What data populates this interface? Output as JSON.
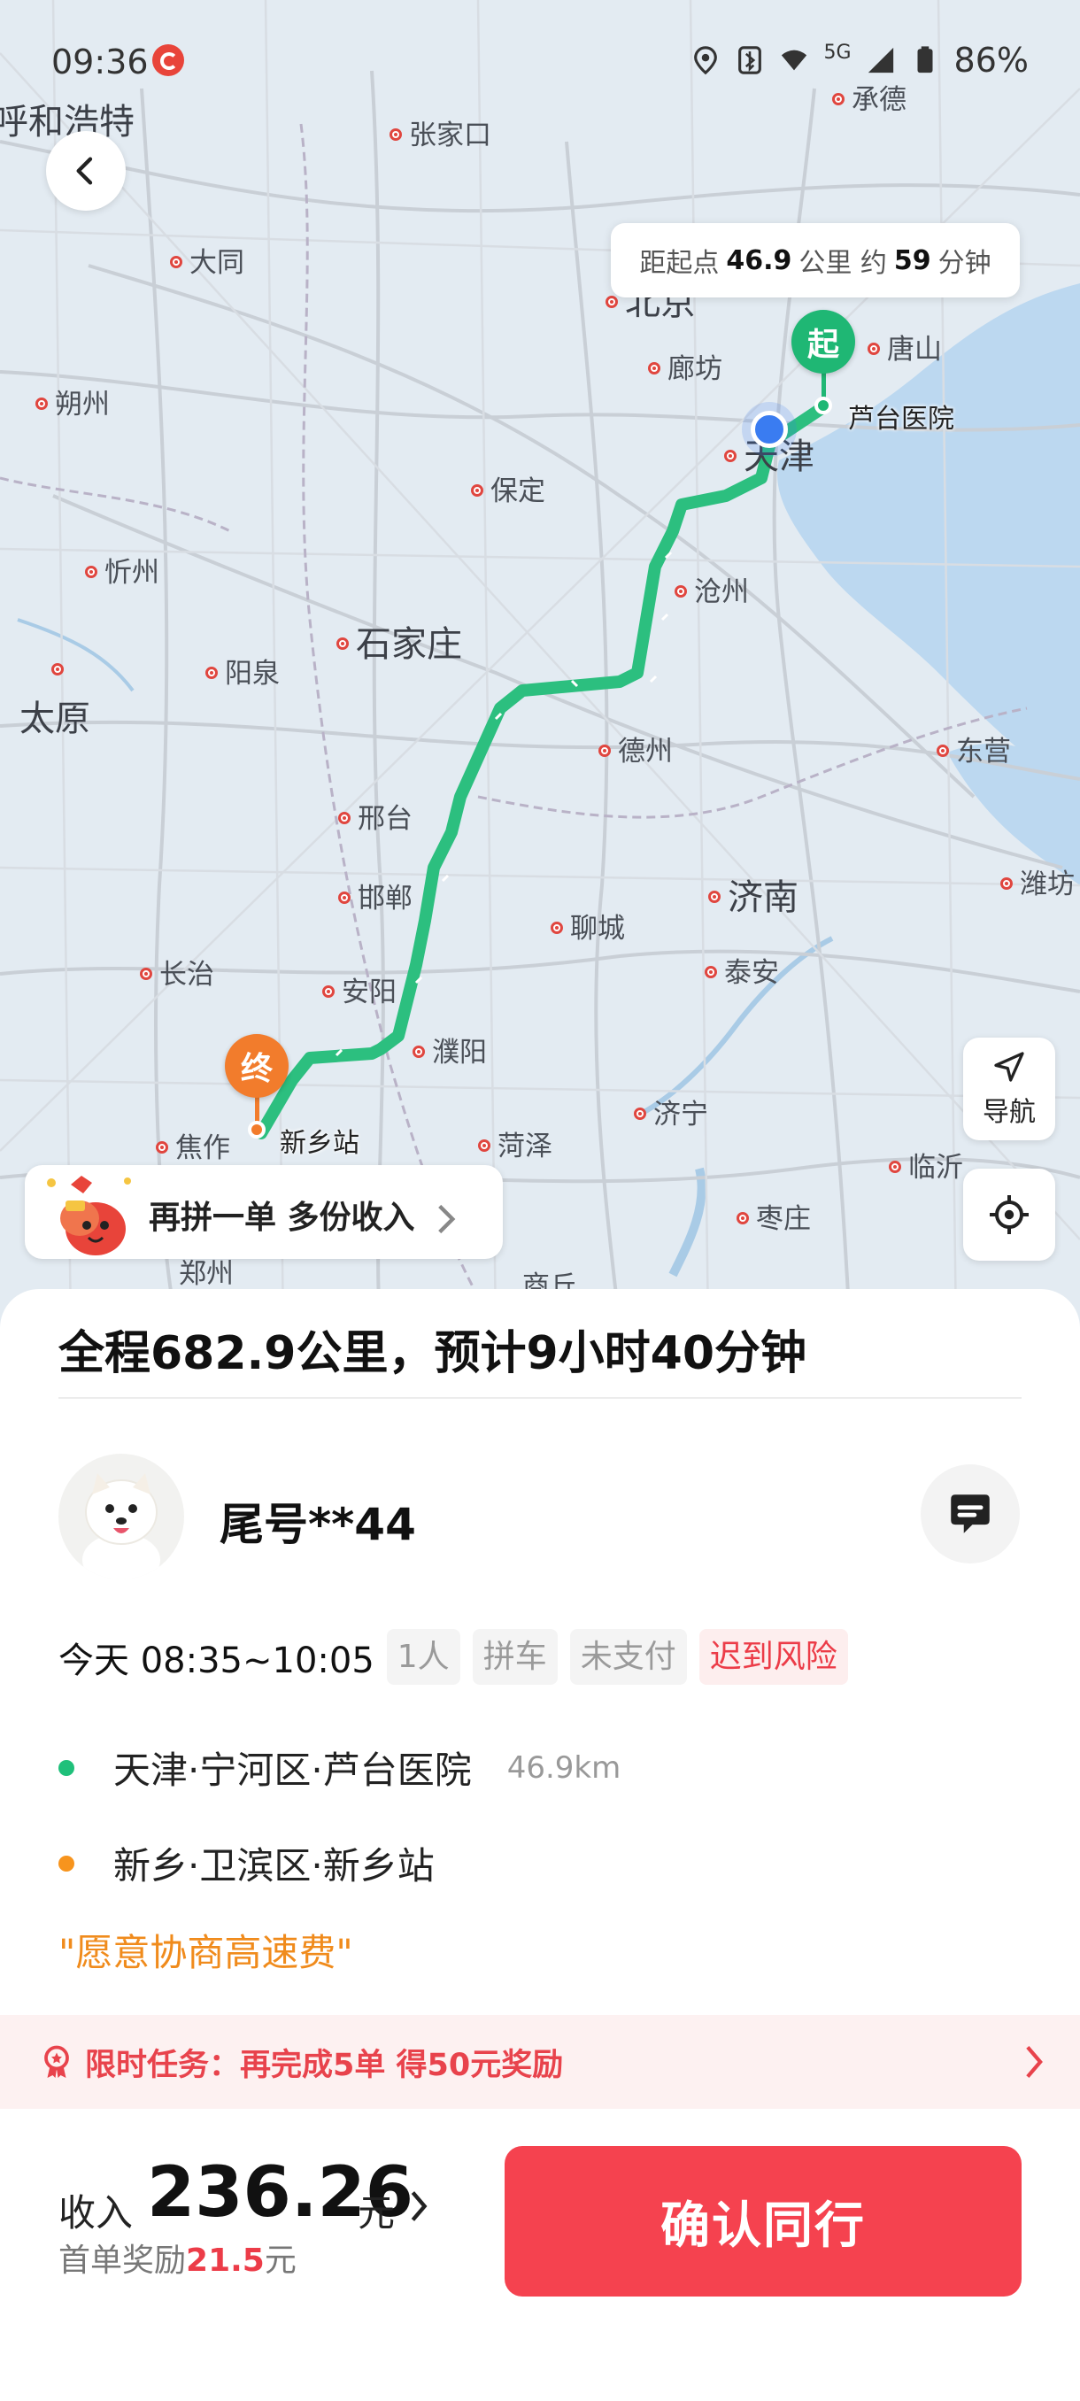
{
  "status_bar": {
    "time": "09:36",
    "battery": "86%",
    "network": "5G"
  },
  "map": {
    "distance_bubble": {
      "prefix": "距起点",
      "km": "46.9",
      "km_unit": "公里 约",
      "min": "59",
      "min_unit": "分钟"
    },
    "start_pin": {
      "text": "起",
      "label": "芦台医院"
    },
    "end_pin": {
      "text": "终",
      "label": "新乡站"
    },
    "cities": [
      {
        "name": "呼和浩特",
        "big": true
      },
      {
        "name": "张家口"
      },
      {
        "name": "承德"
      },
      {
        "name": "大同"
      },
      {
        "name": "北京",
        "big": true
      },
      {
        "name": "唐山"
      },
      {
        "name": "廊坊"
      },
      {
        "name": "朔州"
      },
      {
        "name": "天津",
        "big": true
      },
      {
        "name": "保定"
      },
      {
        "name": "忻州"
      },
      {
        "name": "沧州"
      },
      {
        "name": "石家庄",
        "big": true
      },
      {
        "name": "阳泉"
      },
      {
        "name": "太原",
        "big": true
      },
      {
        "name": "德州"
      },
      {
        "name": "东营"
      },
      {
        "name": "邢台"
      },
      {
        "name": "邯郸"
      },
      {
        "name": "济南",
        "big": true
      },
      {
        "name": "潍坊"
      },
      {
        "name": "聊城"
      },
      {
        "name": "长治"
      },
      {
        "name": "安阳"
      },
      {
        "name": "泰安"
      },
      {
        "name": "濮阳"
      },
      {
        "name": "焦作"
      },
      {
        "name": "菏泽"
      },
      {
        "name": "济宁"
      },
      {
        "name": "临沂"
      },
      {
        "name": "枣庄"
      },
      {
        "name": "郑州"
      },
      {
        "name": "商丘"
      }
    ],
    "nav_button": {
      "label": "导航"
    },
    "promo": {
      "text": "再拼一单 多份收入"
    },
    "colors": {
      "route": "#2cbf7f",
      "start": "#1fb774",
      "end": "#f27c2c",
      "current": "#3a7cf1"
    }
  },
  "order": {
    "summary": "全程682.9公里，预计9小时40分钟",
    "passenger": "尾号**44",
    "time": "今天 08:35~10:05",
    "tags": [
      "1人",
      "拼车",
      "未支付"
    ],
    "risk_tag": "迟到风险",
    "from": {
      "address": "天津·宁河区·芦台医院",
      "distance": "46.9km"
    },
    "to": {
      "address": "新乡·卫滨区·新乡站"
    },
    "remark": "\"愿意协商高速费\""
  },
  "task": {
    "text": "限时任务：再完成5单 得50元奖励"
  },
  "income": {
    "label": "收入",
    "value": "236.26",
    "unit": "元",
    "bonus_label": "首单奖励",
    "bonus_value": "21.5",
    "bonus_unit": "元"
  },
  "confirm_button": "确认同行"
}
